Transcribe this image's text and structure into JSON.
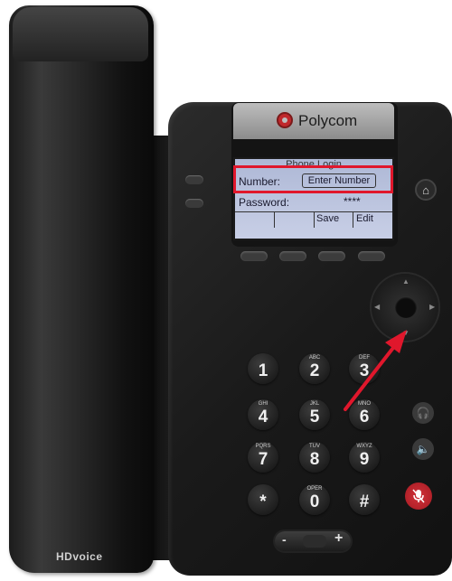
{
  "brand": {
    "name": "Polycom",
    "hd_badge": "HDvoice"
  },
  "screen": {
    "title": "Phone Login",
    "row1_label": "Number:",
    "row1_value": "Enter Number",
    "row2_label": "Password:",
    "row2_value": "****",
    "softkeys": [
      "",
      "",
      "Save",
      "Edit"
    ]
  },
  "keypad": [
    {
      "digit": "1",
      "letters": ""
    },
    {
      "digit": "2",
      "letters": "ABC"
    },
    {
      "digit": "3",
      "letters": "DEF"
    },
    {
      "digit": "4",
      "letters": "GHI"
    },
    {
      "digit": "5",
      "letters": "JKL"
    },
    {
      "digit": "6",
      "letters": "MNO"
    },
    {
      "digit": "7",
      "letters": "PQRS"
    },
    {
      "digit": "8",
      "letters": "TUV"
    },
    {
      "digit": "9",
      "letters": "WXYZ"
    },
    {
      "digit": "*",
      "letters": ""
    },
    {
      "digit": "0",
      "letters": "OPER"
    },
    {
      "digit": "#",
      "letters": ""
    }
  ],
  "volume": {
    "minus": "-",
    "plus": "+"
  },
  "icons": {
    "home": "home-icon",
    "headset": "headset-icon",
    "speaker": "speaker-icon",
    "mute": "microphone-mute-icon"
  },
  "colors": {
    "highlight": "#e0172c",
    "mute": "#c8262e",
    "lcd": "#b9c2de"
  }
}
